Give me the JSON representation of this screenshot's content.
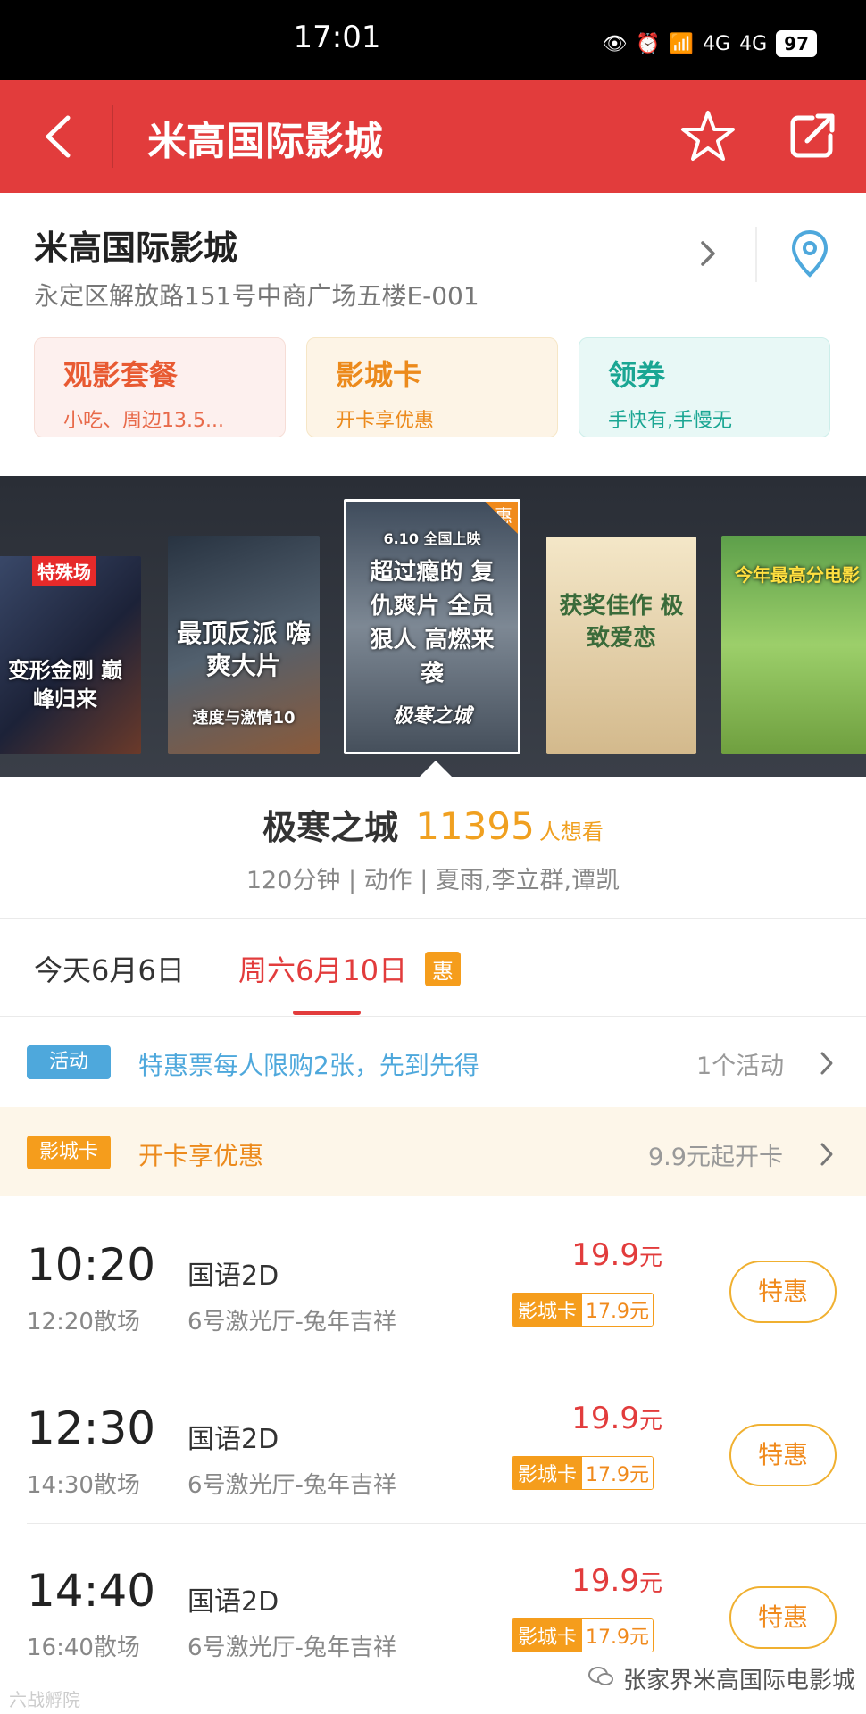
{
  "status_bar": {
    "time": "17:01",
    "signal1": "4G",
    "signal2": "4G",
    "battery": "97"
  },
  "header": {
    "title": "米高国际影城"
  },
  "cinema": {
    "name": "米高国际影城",
    "address": "永定区解放路151号中商广场五楼E-001"
  },
  "promos": [
    {
      "title": "观影套餐",
      "subtitle": "小吃、周边13.5..."
    },
    {
      "title": "影城卡",
      "subtitle": "开卡享优惠"
    },
    {
      "title": "领券",
      "subtitle": "手快有,手慢无"
    }
  ],
  "posters": [
    {
      "tag": "特殊场",
      "text": "变形金刚 巅峰归来"
    },
    {
      "text": "最顶反派 嗨爽大片",
      "sub": "速度与激情10"
    },
    {
      "tag": "惠",
      "text": "超过瘾的 复仇爽片 全员狠人 高燃来袭",
      "date": "6.10 全国上映",
      "sub": "极寒之城"
    },
    {
      "text": "获奖佳作 极致爱恋"
    },
    {
      "text": "今年最高分电影"
    }
  ],
  "movie": {
    "title": "极寒之城",
    "want_count": "11395",
    "want_label": "人想看",
    "meta": "120分钟 | 动作 | 夏雨,李立群,谭凯"
  },
  "dates": {
    "today": "今天6月6日",
    "selected": "周六6月10日",
    "badge": "惠"
  },
  "activity": {
    "badge": "活动",
    "text": "特惠票每人限购2张，先到先得",
    "count": "1个活动"
  },
  "card": {
    "badge": "影城卡",
    "text": "开卡享优惠",
    "price": "9.9元起开卡"
  },
  "showtimes": [
    {
      "start": "10:20",
      "end": "12:20散场",
      "lang": "国语2D",
      "hall": "6号激光厅-兔年吉祥",
      "price": "19.9",
      "unit": "元",
      "card_label": "影城卡",
      "card_price": "17.9元",
      "button": "特惠"
    },
    {
      "start": "12:30",
      "end": "14:30散场",
      "lang": "国语2D",
      "hall": "6号激光厅-兔年吉祥",
      "price": "19.9",
      "unit": "元",
      "card_label": "影城卡",
      "card_price": "17.9元",
      "button": "特惠"
    },
    {
      "start": "14:40",
      "end": "16:40散场",
      "lang": "国语2D",
      "hall": "6号激光厅-兔年吉祥",
      "price": "19.9",
      "unit": "元",
      "card_label": "影城卡",
      "card_price": "17.9元",
      "button": "特惠"
    }
  ],
  "watermarks": {
    "left": "六战孵院",
    "right": "张家界米高国际电影城"
  },
  "colors": {
    "brand_red": "#e23c3c",
    "accent_orange": "#f59d1c",
    "activity_blue": "#4ea8dc"
  },
  "icons": [
    "back-icon",
    "star-icon",
    "share-icon",
    "chevron-right-icon",
    "location-icon",
    "wechat-icon"
  ]
}
